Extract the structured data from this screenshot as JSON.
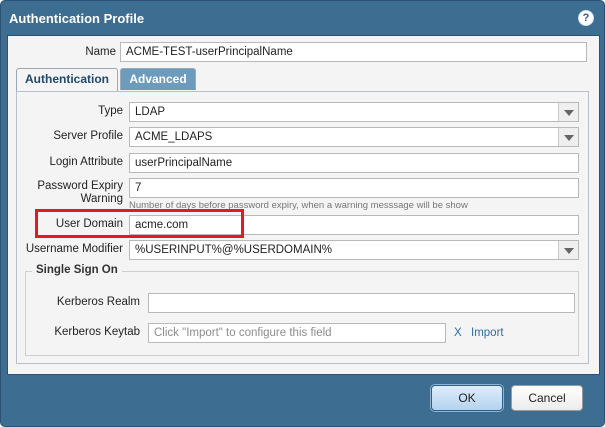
{
  "dialog": {
    "title": "Authentication Profile",
    "help_icon": "help-icon"
  },
  "name": {
    "label": "Name",
    "value": "ACME-TEST-userPrincipalName"
  },
  "tabs": [
    {
      "label": "Authentication",
      "active": true
    },
    {
      "label": "Advanced",
      "active": false
    }
  ],
  "authentication": {
    "type": {
      "label": "Type",
      "value": "LDAP"
    },
    "server_profile": {
      "label": "Server Profile",
      "value": "ACME_LDAPS"
    },
    "login_attribute": {
      "label": "Login Attribute",
      "value": "userPrincipalName"
    },
    "password_expiry": {
      "label_line1": "Password Expiry",
      "label_line2": "Warning",
      "value": "7",
      "hint": "Number of days before password expiry, when a warning messsage will be show"
    },
    "user_domain": {
      "label": "User Domain",
      "value": "acme.com"
    },
    "username_modifier": {
      "label": "Username Modifier",
      "value": "%USERINPUT%@%USERDOMAIN%"
    }
  },
  "sso": {
    "legend": "Single Sign On",
    "kerberos_realm": {
      "label": "Kerberos Realm",
      "value": ""
    },
    "kerberos_keytab": {
      "label": "Kerberos Keytab",
      "placeholder": "Click \"Import\" to configure this field",
      "clear_label": "X",
      "import_label": "Import"
    }
  },
  "buttons": {
    "ok": "OK",
    "cancel": "Cancel"
  },
  "colors": {
    "titlebar": "#3d6d91",
    "highlight": "#e01b24",
    "link": "#2e6ea4"
  }
}
